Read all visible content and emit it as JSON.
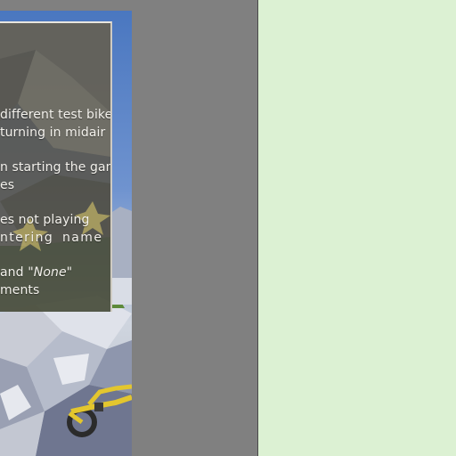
{
  "patch_notes": {
    "lines": [
      {
        "text": "different test bikes"
      },
      {
        "text": "turning in midair"
      },
      {
        "text": "n starting the game"
      },
      {
        "text": "es"
      },
      {
        "text": "es not playing"
      },
      {
        "text": "ntering  name  in"
      },
      {
        "pre": "and ",
        "em": "\"None\""
      },
      {
        "text": "ments"
      }
    ]
  },
  "colors": {
    "gutter": "#808080",
    "right_pane": "#dcf1d3",
    "panel_bg": "#585448",
    "bike_accent": "#e3c62e"
  },
  "icons": {
    "bike": "bike-icon",
    "star": "star-icon"
  }
}
